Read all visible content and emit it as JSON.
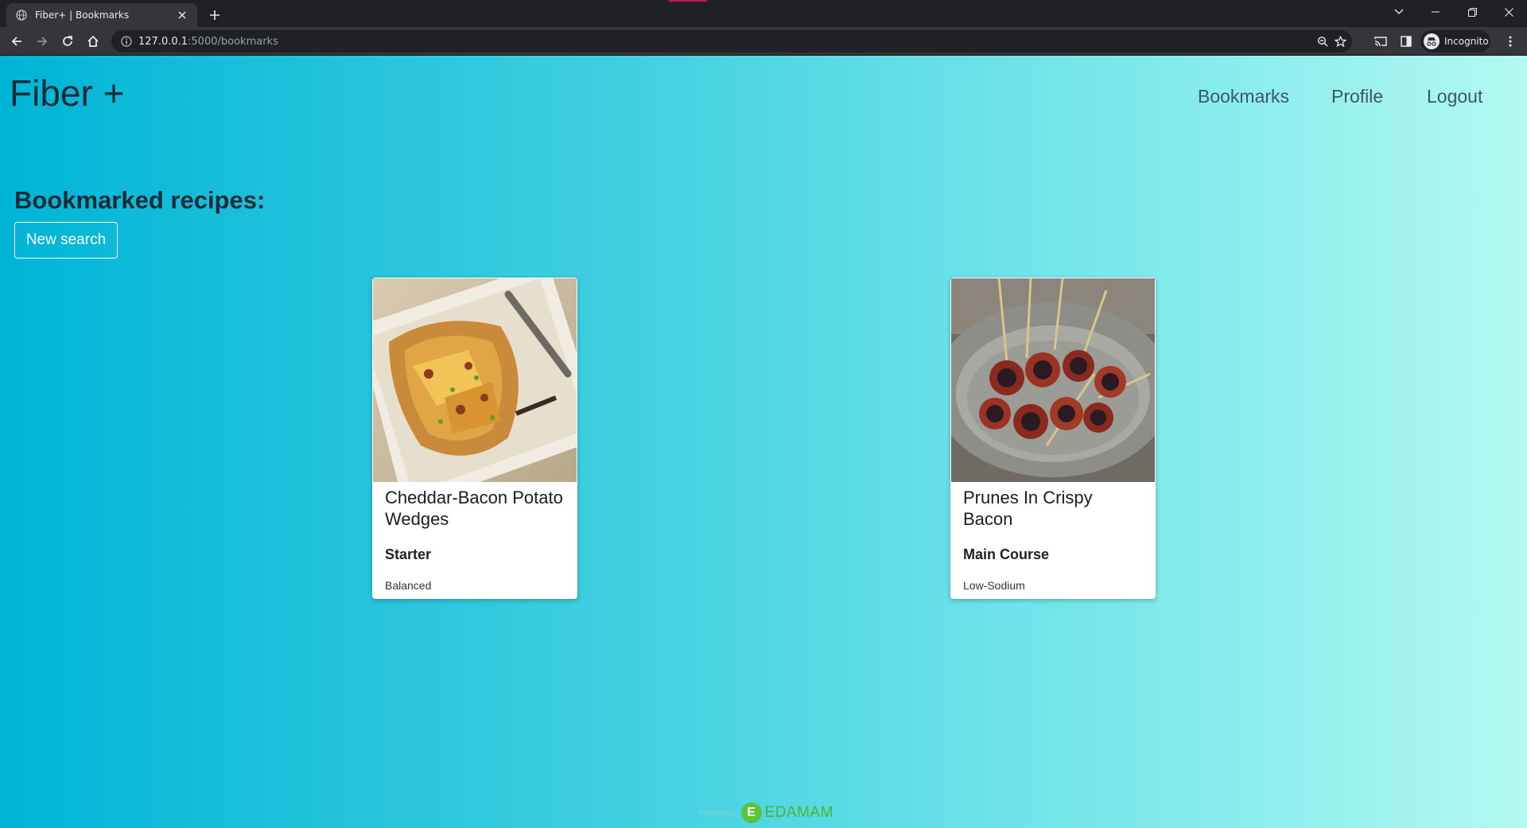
{
  "browser": {
    "tab_title": "Fiber+ | Bookmarks",
    "url_host": "127.0.0.1",
    "url_rest": ":5000/bookmarks",
    "profile_label": "Incognito"
  },
  "site": {
    "brand": "Fiber +",
    "nav": [
      "Bookmarks",
      "Profile",
      "Logout"
    ]
  },
  "main": {
    "heading": "Bookmarked recipes:",
    "new_search_label": "New search",
    "cards": [
      {
        "title": "Cheddar-Bacon Potato Wedges",
        "meal_type": "Starter",
        "diet": "Balanced"
      },
      {
        "title": "Prunes In Crispy Bacon",
        "meal_type": "Main Course",
        "diet": "Low-Sodium"
      }
    ]
  },
  "footer": {
    "powered_by": "Powered by",
    "brand": "EDAMAM"
  }
}
